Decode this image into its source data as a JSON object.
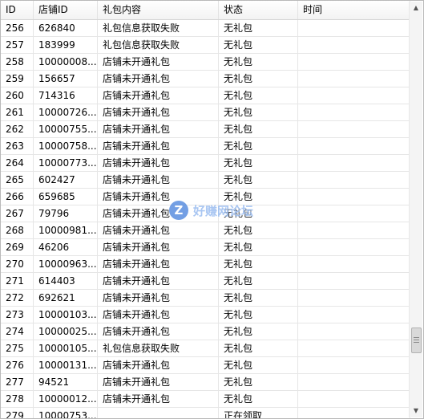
{
  "columns": [
    "ID",
    "店铺ID",
    "礼包内容",
    "状态",
    "时间"
  ],
  "rows": [
    [
      "256",
      "626840",
      "礼包信息获取失败",
      "无礼包",
      ""
    ],
    [
      "257",
      "183999",
      "礼包信息获取失败",
      "无礼包",
      ""
    ],
    [
      "258",
      "10000008...",
      "店铺未开通礼包",
      "无礼包",
      ""
    ],
    [
      "259",
      "156657",
      "店铺未开通礼包",
      "无礼包",
      ""
    ],
    [
      "260",
      "714316",
      "店铺未开通礼包",
      "无礼包",
      ""
    ],
    [
      "261",
      "10000726...",
      "店铺未开通礼包",
      "无礼包",
      ""
    ],
    [
      "262",
      "10000755...",
      "店铺未开通礼包",
      "无礼包",
      ""
    ],
    [
      "263",
      "10000758...",
      "店铺未开通礼包",
      "无礼包",
      ""
    ],
    [
      "264",
      "10000773...",
      "店铺未开通礼包",
      "无礼包",
      ""
    ],
    [
      "265",
      "602427",
      "店铺未开通礼包",
      "无礼包",
      ""
    ],
    [
      "266",
      "659685",
      "店铺未开通礼包",
      "无礼包",
      ""
    ],
    [
      "267",
      "79796",
      "店铺未开通礼包",
      "无礼包",
      ""
    ],
    [
      "268",
      "10000981...",
      "店铺未开通礼包",
      "无礼包",
      ""
    ],
    [
      "269",
      "46206",
      "店铺未开通礼包",
      "无礼包",
      ""
    ],
    [
      "270",
      "10000963...",
      "店铺未开通礼包",
      "无礼包",
      ""
    ],
    [
      "271",
      "614403",
      "店铺未开通礼包",
      "无礼包",
      ""
    ],
    [
      "272",
      "692621",
      "店铺未开通礼包",
      "无礼包",
      ""
    ],
    [
      "273",
      "10000103...",
      "店铺未开通礼包",
      "无礼包",
      ""
    ],
    [
      "274",
      "10000025...",
      "店铺未开通礼包",
      "无礼包",
      ""
    ],
    [
      "275",
      "10000105...",
      "礼包信息获取失败",
      "无礼包",
      ""
    ],
    [
      "276",
      "10000131...",
      "店铺未开通礼包",
      "无礼包",
      ""
    ],
    [
      "277",
      "94521",
      "店铺未开通礼包",
      "无礼包",
      ""
    ],
    [
      "278",
      "10000012...",
      "店铺未开通礼包",
      "无礼包",
      ""
    ],
    [
      "279",
      "10000753...",
      "",
      "正在领取",
      ""
    ]
  ],
  "watermark": {
    "badge": "Z",
    "text": "好赚网论坛"
  },
  "icons": {
    "scroll_up": "scroll-up-arrow-icon",
    "scroll_down": "scroll-down-arrow-icon"
  },
  "colors": {
    "header_bg": "#f3f3f3",
    "gridline": "#e6e6e6",
    "watermark": "#5b8fe0"
  }
}
